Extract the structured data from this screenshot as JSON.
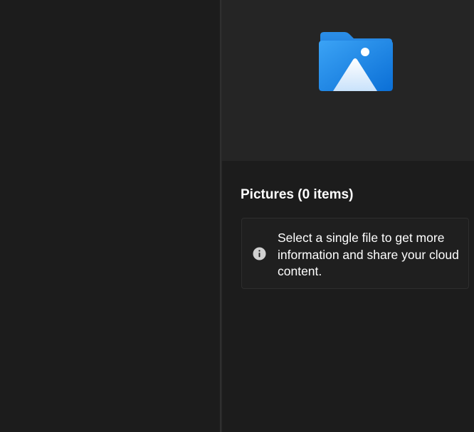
{
  "details_pane": {
    "preview_icon": "pictures-folder-icon",
    "title": "Pictures (0 items)",
    "info_icon": "info-icon",
    "info_message": "Select a single file to get more information and share your cloud content."
  },
  "colors": {
    "background": "#1c1c1c",
    "preview_background": "#252525",
    "folder_blue_light": "#2b8ee8",
    "folder_blue_dark": "#0a63c9",
    "text": "#ffffff"
  }
}
